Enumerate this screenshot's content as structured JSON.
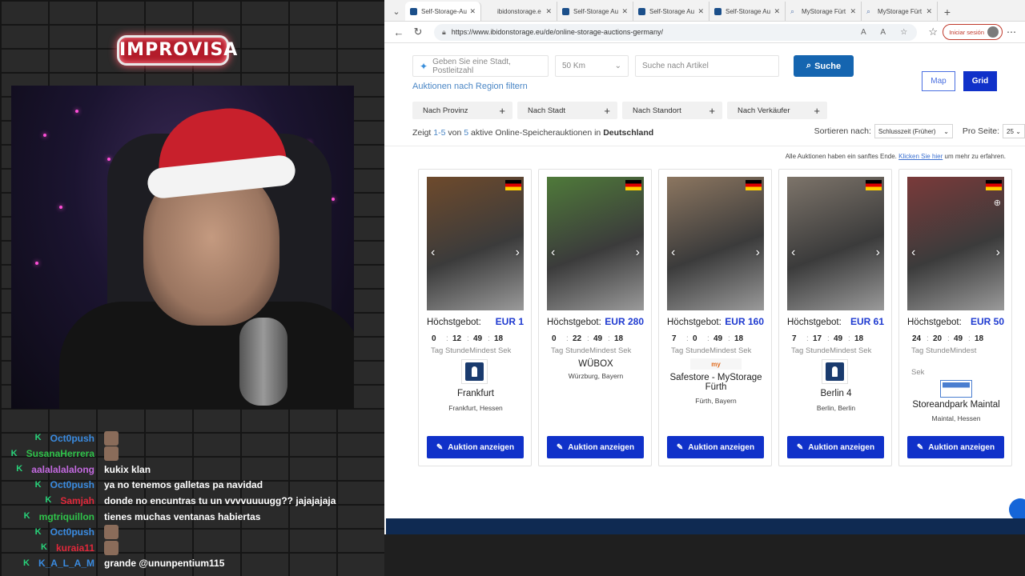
{
  "stream": {
    "logo_text": "IMPROVISA",
    "chat": [
      {
        "user": "Oct0push",
        "color": "#3a8be0",
        "message": "",
        "emote": true
      },
      {
        "user": "SusanaHerrera",
        "color": "#2fc24a",
        "message": "",
        "emote": true
      },
      {
        "user": "aalalalalalong",
        "color": "#c36ae0",
        "message": "kukix klan",
        "emote": false
      },
      {
        "user": "Oct0push",
        "color": "#3a8be0",
        "message": "ya no tenemos galletas pa navidad",
        "emote": false
      },
      {
        "user": "Samjah",
        "color": "#e0283a",
        "message": "donde no encuntras tu un vvvvuuuugg?? jajajajaja",
        "emote": false
      },
      {
        "user": "mgtriquillon",
        "color": "#2fc24a",
        "message": "tienes muchas ventanas habiertas",
        "emote": false
      },
      {
        "user": "Oct0push",
        "color": "#3a8be0",
        "message": "",
        "emote": true
      },
      {
        "user": "kuraia11",
        "color": "#e0283a",
        "message": "",
        "emote": true
      },
      {
        "user": "K_A_L_A_M",
        "color": "#3a8be0",
        "message": "grande @ununpentium115",
        "emote": false
      }
    ]
  },
  "browser": {
    "tabs": [
      {
        "label": "Self-Storage-Au",
        "active": true,
        "icon": "site"
      },
      {
        "label": "ibidonstorage.e",
        "active": false,
        "icon": "none"
      },
      {
        "label": "Self-Storage Au",
        "active": false,
        "icon": "site"
      },
      {
        "label": "Self-Storage Au",
        "active": false,
        "icon": "site"
      },
      {
        "label": "Self-Storage Au",
        "active": false,
        "icon": "site"
      },
      {
        "label": "MyStorage Fürt",
        "active": false,
        "icon": "search"
      },
      {
        "label": "MyStorage Fürt",
        "active": false,
        "icon": "search"
      }
    ],
    "url": "https://www.ibidonstorage.eu/de/online-storage-auctions-germany/",
    "signin_label": "Iniciar sesión"
  },
  "page": {
    "search": {
      "city_placeholder": "Geben Sie eine Stadt, Postleitzahl",
      "radius": "50 Km",
      "article_placeholder": "Suche nach Artikel",
      "button": "Suche"
    },
    "view": {
      "map": "Map",
      "grid": "Grid"
    },
    "filter_link": "Auktionen nach Region filtern",
    "filters": [
      {
        "label": "Nach Provinz"
      },
      {
        "label": "Nach Stadt"
      },
      {
        "label": "Nach Standort"
      },
      {
        "label": "Nach Verkäufer"
      }
    ],
    "summary": {
      "prefix": "Zeigt",
      "range": "1-5",
      "of": "von",
      "count": "5",
      "middle": "aktive Online-Speicherauktionen in",
      "country": "Deutschland"
    },
    "sort": {
      "label": "Sortieren nach:",
      "value": "Schlusszeit (Früher)",
      "per_page_label": "Pro Seite:",
      "per_page": "25"
    },
    "soft_note": {
      "text": "Alle Auktionen haben ein sanftes Ende.",
      "link": "Klicken Sie hier",
      "suffix": "um mehr zu erfahren."
    },
    "bid_label": "Höchstgebot:",
    "timer_labels": "Tag StundeMindest Sek",
    "cta": "Auktion anzeigen",
    "auctions": [
      {
        "bid": "EUR 1",
        "d": "0",
        "h": "12",
        "m": "49",
        "s": "18",
        "name": "Frankfurt",
        "location": "Frankfurt, Hessen",
        "logo": "keyhole",
        "photo": "#6e4a2c"
      },
      {
        "bid": "EUR 280",
        "d": "0",
        "h": "22",
        "m": "49",
        "s": "18",
        "name": "WÜBOX",
        "location": "Würzburg, Bayern",
        "logo": "none",
        "photo": "#4f7a3a"
      },
      {
        "bid": "EUR 160",
        "d": "7",
        "h": "0",
        "m": "49",
        "s": "18",
        "name": "Safestore - MyStorage Fürth",
        "location": "Fürth, Bayern",
        "logo": "mystorage",
        "logo_text": "my",
        "photo": "#8c7660"
      },
      {
        "bid": "EUR 61",
        "d": "7",
        "h": "17",
        "m": "49",
        "s": "18",
        "name": "Berlin 4",
        "location": "Berlin, Berlin",
        "logo": "keyhole",
        "photo": "#7d746a"
      },
      {
        "bid": "EUR 50",
        "d": "24",
        "h": "20",
        "m": "49",
        "s": "18",
        "name": "Storeandpark Maintal",
        "location": "Maintal, Hessen",
        "logo": "storepark",
        "photo": "#7a3a3a",
        "timer_labels": "Tag StundeMindest",
        "timer_extra": "Sek"
      }
    ]
  }
}
